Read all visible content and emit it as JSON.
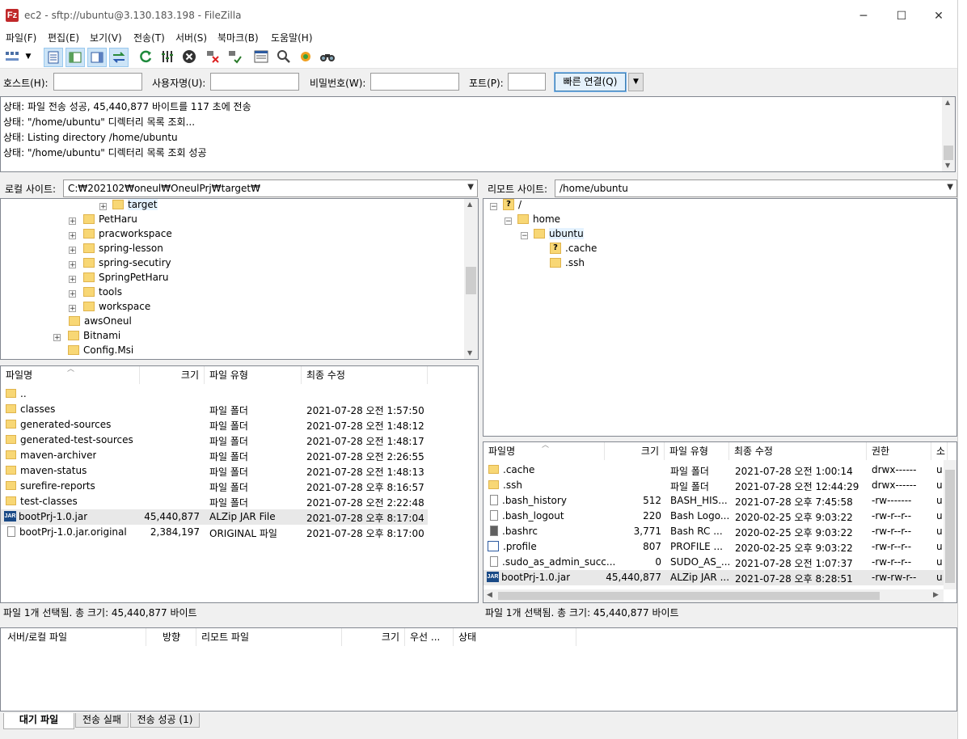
{
  "window": {
    "title": "ec2 - sftp://ubuntu@3.130.183.198 - FileZilla",
    "app_icon_text": "Fz",
    "minimize_glyph": "─",
    "maximize_glyph": "☐",
    "close_glyph": "✕"
  },
  "menu": [
    "파일(F)",
    "편집(E)",
    "보기(V)",
    "전송(T)",
    "서버(S)",
    "북마크(B)",
    "도움말(H)"
  ],
  "quickconnect": {
    "host_label": "호스트(H):",
    "user_label": "사용자명(U):",
    "pass_label": "비밀번호(W):",
    "port_label": "포트(P):",
    "connect_button": "빠른 연결(Q)",
    "host_value": "",
    "user_value": "",
    "pass_value": "",
    "port_value": ""
  },
  "log": [
    "상태: 파일 전송 성공, 45,440,877 바이트를 117 초에 전송",
    "상태: \"/home/ubuntu\" 디렉터리 목록 조회...",
    "상태: Listing directory /home/ubuntu",
    "상태: \"/home/ubuntu\" 디렉터리 목록 조회 성공"
  ],
  "local": {
    "site_label": "로컬 사이트:",
    "path": "C:₩202102₩oneul₩OneulPrj₩target₩",
    "tree": [
      "target",
      "PetHaru",
      "pracworkspace",
      "spring-lesson",
      "spring-secutiry",
      "SpringPetHaru",
      "tools",
      "workspace",
      "awsOneul",
      "Bitnami",
      "Config.Msi"
    ],
    "headers": [
      "파일명",
      "크기",
      "파일 유형",
      "최종 수정"
    ],
    "files": [
      {
        "name": "..",
        "size": "",
        "type": "",
        "modified": ""
      },
      {
        "name": "classes",
        "size": "",
        "type": "파일 폴더",
        "modified": "2021-07-28 오전 1:57:50"
      },
      {
        "name": "generated-sources",
        "size": "",
        "type": "파일 폴더",
        "modified": "2021-07-28 오전 1:48:12"
      },
      {
        "name": "generated-test-sources",
        "size": "",
        "type": "파일 폴더",
        "modified": "2021-07-28 오전 1:48:17"
      },
      {
        "name": "maven-archiver",
        "size": "",
        "type": "파일 폴더",
        "modified": "2021-07-28 오전 2:26:55"
      },
      {
        "name": "maven-status",
        "size": "",
        "type": "파일 폴더",
        "modified": "2021-07-28 오전 1:48:13"
      },
      {
        "name": "surefire-reports",
        "size": "",
        "type": "파일 폴더",
        "modified": "2021-07-28 오후 8:16:57"
      },
      {
        "name": "test-classes",
        "size": "",
        "type": "파일 폴더",
        "modified": "2021-07-28 오전 2:22:48"
      },
      {
        "name": "bootPrj-1.0.jar",
        "size": "45,440,877",
        "type": "ALZip JAR File",
        "modified": "2021-07-28 오후 8:17:04"
      },
      {
        "name": "bootPrj-1.0.jar.original",
        "size": "2,384,197",
        "type": "ORIGINAL 파일",
        "modified": "2021-07-28 오후 8:17:00"
      }
    ],
    "status": "파일 1개 선택됨. 총 크기: 45,440,877 바이트"
  },
  "remote": {
    "site_label": "리모트 사이트:",
    "path": "/home/ubuntu",
    "tree": [
      "/",
      "home",
      "ubuntu",
      ".cache",
      ".ssh"
    ],
    "headers": [
      "파일명",
      "크기",
      "파일 유형",
      "최종 수정",
      "권한",
      "소"
    ],
    "files": [
      {
        "name": ".cache",
        "size": "",
        "type": "파일 폴더",
        "modified": "2021-07-28 오전 1:00:14",
        "perm": "drwx------",
        "owner": "u"
      },
      {
        "name": ".ssh",
        "size": "",
        "type": "파일 폴더",
        "modified": "2021-07-28 오전 12:44:29",
        "perm": "drwx------",
        "owner": "u"
      },
      {
        "name": ".bash_history",
        "size": "512",
        "type": "BASH_HIS...",
        "modified": "2021-07-28 오후 7:45:58",
        "perm": "-rw-------",
        "owner": "u"
      },
      {
        "name": ".bash_logout",
        "size": "220",
        "type": "Bash Logo...",
        "modified": "2020-02-25 오후 9:03:22",
        "perm": "-rw-r--r--",
        "owner": "u"
      },
      {
        "name": ".bashrc",
        "size": "3,771",
        "type": "Bash RC ...",
        "modified": "2020-02-25 오후 9:03:22",
        "perm": "-rw-r--r--",
        "owner": "u"
      },
      {
        "name": ".profile",
        "size": "807",
        "type": "PROFILE ...",
        "modified": "2020-02-25 오후 9:03:22",
        "perm": "-rw-r--r--",
        "owner": "u"
      },
      {
        "name": ".sudo_as_admin_succ...",
        "size": "0",
        "type": "SUDO_AS_...",
        "modified": "2021-07-28 오전 1:07:37",
        "perm": "-rw-r--r--",
        "owner": "u"
      },
      {
        "name": "bootPrj-1.0.jar",
        "size": "45,440,877",
        "type": "ALZip JAR ...",
        "modified": "2021-07-28 오후 8:28:51",
        "perm": "-rw-rw-r--",
        "owner": "u"
      }
    ],
    "status": "파일 1개 선택됨. 총 크기: 45,440,877 바이트"
  },
  "queue": {
    "headers": [
      "서버/로컬 파일",
      "방향",
      "리모트 파일",
      "크기",
      "우선 ...",
      "상태"
    ]
  },
  "tabs": [
    "대기 파일",
    "전송 실패",
    "전송 성공 (1)"
  ],
  "jar_icon_text": "JAR",
  "question_mark": "?"
}
